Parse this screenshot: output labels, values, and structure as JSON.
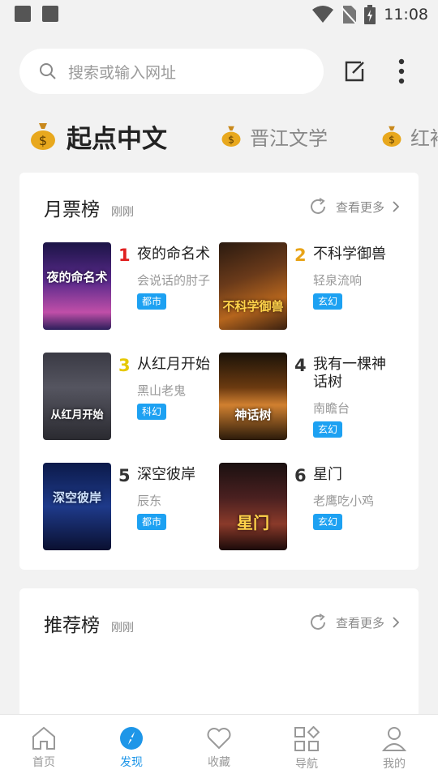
{
  "status_bar": {
    "time": "11:08"
  },
  "search": {
    "placeholder": "搜索或输入网址"
  },
  "sources": [
    {
      "label": "起点中文",
      "active": true
    },
    {
      "label": "晋江文学",
      "active": false
    },
    {
      "label": "红袖",
      "active": false
    }
  ],
  "sections": [
    {
      "title": "月票榜",
      "time": "刚刚",
      "more_label": "查看更多",
      "books": [
        {
          "rank": "1",
          "title": "夜的命名术",
          "author": "会说话的肘子",
          "tag": "都市",
          "cover_text": "夜的命名术"
        },
        {
          "rank": "2",
          "title": "不科学御兽",
          "author": "轻泉流响",
          "tag": "玄幻",
          "cover_text": "不科学御兽"
        },
        {
          "rank": "3",
          "title": "从红月开始",
          "author": "黑山老鬼",
          "tag": "科幻",
          "cover_text": "从红月开始"
        },
        {
          "rank": "4",
          "title": "我有一棵神话树",
          "author": "南瞻台",
          "tag": "玄幻",
          "cover_text": "神话树"
        },
        {
          "rank": "5",
          "title": "深空彼岸",
          "author": "辰东",
          "tag": "都市",
          "cover_text": "深空彼岸"
        },
        {
          "rank": "6",
          "title": "星门",
          "author": "老鹰吃小鸡",
          "tag": "玄幻",
          "cover_text": "星门"
        }
      ]
    },
    {
      "title": "推荐榜",
      "time": "刚刚",
      "more_label": "查看更多"
    }
  ],
  "tabbar": [
    {
      "label": "首页",
      "icon": "home-icon",
      "active": false
    },
    {
      "label": "发现",
      "icon": "compass-icon",
      "active": true
    },
    {
      "label": "收藏",
      "icon": "heart-icon",
      "active": false
    },
    {
      "label": "导航",
      "icon": "grid-icon",
      "active": false
    },
    {
      "label": "我的",
      "icon": "user-icon",
      "active": false
    }
  ],
  "colors": {
    "accent": "#1e96e8",
    "tag": "#1da1f2",
    "rank1": "#e02020",
    "rank2": "#e8a317",
    "rank3": "#e6c800",
    "rank_other": "#333333"
  }
}
